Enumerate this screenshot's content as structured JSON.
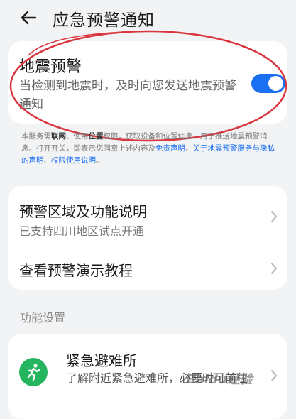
{
  "header": {
    "title": "应急预警通知"
  },
  "earthquake": {
    "title": "地震预警",
    "description": "当检测到地震时，及时向您发送地震预警通知",
    "toggle_on": true,
    "accent_color": "#1b6ff2"
  },
  "notice": {
    "p1": "本服务需",
    "b1": "联网",
    "p2": "、使用",
    "b2": "位置",
    "p3": "权限，获取设备和位置信息，用于推送地震预警消息。打开开关，即表示您同意上述内容及",
    "l1": "免责声明",
    "p4": "、",
    "l2": "关于地震预警服务与隐私的声明",
    "p5": "、",
    "l3": "权限使用说明",
    "p6": "。"
  },
  "info": {
    "region_title": "预警区域及功能说明",
    "region_sub": "已支持四川地区试点开通",
    "demo_title": "查看预警演示教程"
  },
  "settings": {
    "section_label": "功能设置",
    "shelter_title": "紧急避难所",
    "shelter_desc": "了解附近紧急避难所，必要时可前往",
    "icon": "running-person-icon",
    "icon_color": "#25b55f"
  },
  "watermark": "Baidu经验"
}
